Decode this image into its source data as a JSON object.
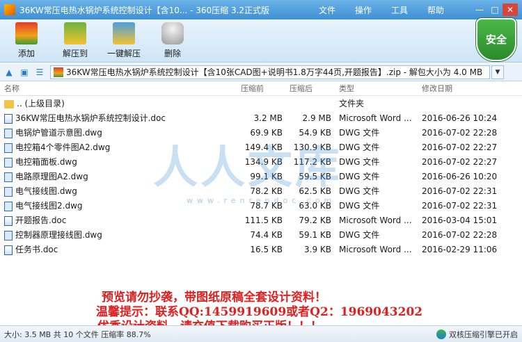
{
  "window": {
    "title": "36KW常压电热水锅炉系统控制设计【含10... - 360压缩 3.2正式版",
    "menu": [
      "文件",
      "操作",
      "工具",
      "帮助"
    ],
    "controls": {
      "minimize": "—",
      "maximize": "□",
      "close": "✕"
    }
  },
  "toolbar": {
    "add_label": "添加",
    "extract_label": "解压到",
    "onekey_label": "一键解压",
    "delete_label": "删除",
    "security_badge": "安全"
  },
  "address": {
    "path": "36KW常压电热水锅炉系统控制设计【含10张CAD图+说明书1.8万字44页,开题报告】.zip - 解包大小为 4.0 MB",
    "dropdown": "▼"
  },
  "columns": {
    "name": "名称",
    "size": "压缩前",
    "packed": "压缩后",
    "type": "类型",
    "modified": "修改日期"
  },
  "files": [
    {
      "icon": "folder",
      "name": ".. (上级目录)",
      "size": "",
      "packed": "",
      "type": "文件夹",
      "modified": ""
    },
    {
      "icon": "doc",
      "name": "36KW常压电热水锅炉系统控制设计.doc",
      "size": "3.2 MB",
      "packed": "2.9 MB",
      "type": "Microsoft Word ...",
      "modified": "2016-06-26 10:24"
    },
    {
      "icon": "dwg",
      "name": "电锅炉管道示意图.dwg",
      "size": "69.9 KB",
      "packed": "54.9 KB",
      "type": "DWG 文件",
      "modified": "2016-07-02 22:28"
    },
    {
      "icon": "dwg",
      "name": "电控箱4个零件图A2.dwg",
      "size": "149.4 KB",
      "packed": "130.9 KB",
      "type": "DWG 文件",
      "modified": "2016-07-02 22:27"
    },
    {
      "icon": "dwg",
      "name": "电控箱面板.dwg",
      "size": "134.9 KB",
      "packed": "117.2 KB",
      "type": "DWG 文件",
      "modified": "2016-07-02 22:27"
    },
    {
      "icon": "dwg",
      "name": "电路原理图A2.dwg",
      "size": "99.1 KB",
      "packed": "59.5 KB",
      "type": "DWG 文件",
      "modified": "2016-06-26 10:20"
    },
    {
      "icon": "dwg",
      "name": "电气接线图.dwg",
      "size": "78.2 KB",
      "packed": "62.5 KB",
      "type": "DWG 文件",
      "modified": "2016-07-02 22:31"
    },
    {
      "icon": "dwg",
      "name": "电气接线图2.dwg",
      "size": "78.7 KB",
      "packed": "63.0 KB",
      "type": "DWG 文件",
      "modified": "2016-07-02 22:31"
    },
    {
      "icon": "doc",
      "name": "开题报告.doc",
      "size": "111.5 KB",
      "packed": "79.2 KB",
      "type": "Microsoft Word ...",
      "modified": "2016-03-04 15:01"
    },
    {
      "icon": "dwg",
      "name": "控制器原理接线图.dwg",
      "size": "74.4 KB",
      "packed": "59.1 KB",
      "type": "DWG 文件",
      "modified": "2016-07-02 22:28"
    },
    {
      "icon": "doc",
      "name": "任务书.doc",
      "size": "16.5 KB",
      "packed": "3.9 KB",
      "type": "Microsoft Word ...",
      "modified": "2016-02-29 11:06"
    }
  ],
  "watermark": {
    "big": "人人文库",
    "small": "www.renrendoc.com"
  },
  "notice": {
    "line1": "预览请勿抄袭，带图纸原稿全套设计资料！",
    "line2": "温馨提示：联系QQ:1459919609或者Q2：1969043202",
    "line3": "优秀设计资料，请充值下载购买正版！！！"
  },
  "status": {
    "left": "大小: 3.5 MB 共 10 个文件 压缩率 88.7%",
    "right": "双核压缩引擎已开启"
  }
}
